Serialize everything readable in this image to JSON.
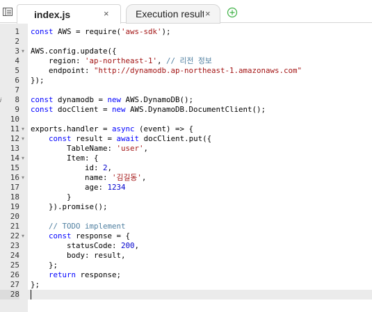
{
  "tabs": [
    {
      "label": "index.js",
      "close": "×",
      "active": true
    },
    {
      "label": "Execution results",
      "close": "×",
      "active": false
    }
  ],
  "icons": {
    "panel_toggle": "panel-toggle-icon",
    "add_tab": "add-tab-icon",
    "fold": "▾",
    "annotation": "i"
  },
  "colors": {
    "keyword": "#0000ff",
    "string": "#a31515",
    "comment": "#4f7fa0",
    "number": "#0000cd",
    "add_tab": "#3cb043"
  },
  "editor": {
    "active_line": 28,
    "annotation_line": 8,
    "fold_lines": [
      3,
      11,
      12,
      14,
      16,
      22
    ],
    "lines": [
      [
        [
          "kw",
          "const"
        ],
        [
          "t",
          " AWS = require("
        ],
        [
          "str",
          "'aws-sdk'"
        ],
        [
          "t",
          ");"
        ]
      ],
      [],
      [
        [
          "t",
          "AWS.config.update({"
        ]
      ],
      [
        [
          "t",
          "    region: "
        ],
        [
          "str",
          "'ap-northeast-1'"
        ],
        [
          "t",
          ", "
        ],
        [
          "cm",
          "// 리전 정보"
        ]
      ],
      [
        [
          "t",
          "    endpoint: "
        ],
        [
          "str",
          "\"http://dynamodb.ap-northeast-1.amazonaws.com\""
        ]
      ],
      [
        [
          "t",
          "});"
        ]
      ],
      [],
      [
        [
          "kw",
          "const"
        ],
        [
          "t",
          " dynamodb = "
        ],
        [
          "kw",
          "new"
        ],
        [
          "t",
          " AWS.DynamoDB();"
        ]
      ],
      [
        [
          "kw",
          "const"
        ],
        [
          "t",
          " docClient = "
        ],
        [
          "kw",
          "new"
        ],
        [
          "t",
          " AWS.DynamoDB.DocumentClient();"
        ]
      ],
      [],
      [
        [
          "t",
          "exports.handler = "
        ],
        [
          "kw",
          "async"
        ],
        [
          "t",
          " (event) => {"
        ]
      ],
      [
        [
          "t",
          "    "
        ],
        [
          "kw",
          "const"
        ],
        [
          "t",
          " result = "
        ],
        [
          "kw",
          "await"
        ],
        [
          "t",
          " docClient.put({"
        ]
      ],
      [
        [
          "t",
          "        TableName: "
        ],
        [
          "str",
          "'user'"
        ],
        [
          "t",
          ","
        ]
      ],
      [
        [
          "t",
          "        Item: {"
        ]
      ],
      [
        [
          "t",
          "            id: "
        ],
        [
          "num",
          "2"
        ],
        [
          "t",
          ","
        ]
      ],
      [
        [
          "t",
          "            name: "
        ],
        [
          "str",
          "'김길동'"
        ],
        [
          "t",
          ","
        ]
      ],
      [
        [
          "t",
          "            age: "
        ],
        [
          "num",
          "1234"
        ]
      ],
      [
        [
          "t",
          "        }"
        ]
      ],
      [
        [
          "t",
          "    }).promise();"
        ]
      ],
      [],
      [
        [
          "t",
          "    "
        ],
        [
          "cm",
          "// TODO implement"
        ]
      ],
      [
        [
          "t",
          "    "
        ],
        [
          "kw",
          "const"
        ],
        [
          "t",
          " response = {"
        ]
      ],
      [
        [
          "t",
          "        statusCode: "
        ],
        [
          "num",
          "200"
        ],
        [
          "t",
          ","
        ]
      ],
      [
        [
          "t",
          "        body: result,"
        ]
      ],
      [
        [
          "t",
          "    };"
        ]
      ],
      [
        [
          "t",
          "    "
        ],
        [
          "kw",
          "return"
        ],
        [
          "t",
          " response;"
        ]
      ],
      [
        [
          "t",
          "};"
        ]
      ],
      []
    ]
  }
}
